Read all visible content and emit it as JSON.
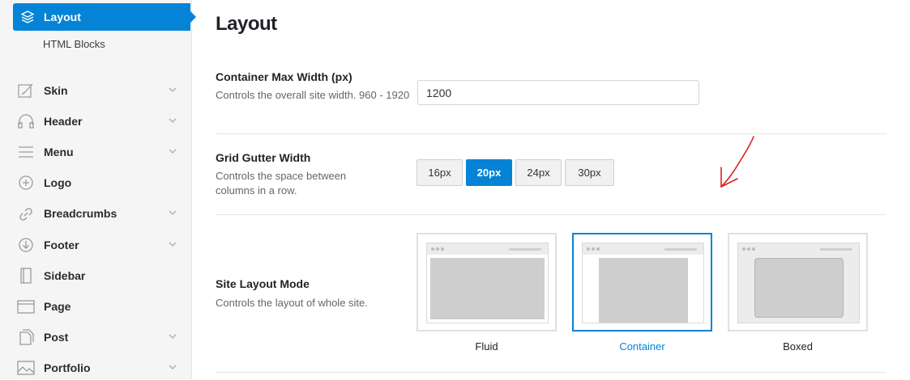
{
  "sidebar": {
    "active": {
      "label": "Layout",
      "icon": "layers-icon"
    },
    "sub_items": [
      {
        "label": "HTML Blocks"
      }
    ],
    "items": [
      {
        "label": "Skin",
        "icon": "skin-icon",
        "has_children": true
      },
      {
        "label": "Header",
        "icon": "headphones-icon",
        "has_children": true
      },
      {
        "label": "Menu",
        "icon": "menu-icon",
        "has_children": true
      },
      {
        "label": "Logo",
        "icon": "plus-circle-icon",
        "has_children": false
      },
      {
        "label": "Breadcrumbs",
        "icon": "link-icon",
        "has_children": true
      },
      {
        "label": "Footer",
        "icon": "arrow-down-circle-icon",
        "has_children": true
      },
      {
        "label": "Sidebar",
        "icon": "sidebar-icon",
        "has_children": false
      },
      {
        "label": "Page",
        "icon": "page-icon",
        "has_children": false
      },
      {
        "label": "Post",
        "icon": "post-icon",
        "has_children": true
      },
      {
        "label": "Portfolio",
        "icon": "image-icon",
        "has_children": true
      }
    ]
  },
  "main": {
    "title": "Layout",
    "container_width": {
      "title": "Container Max Width (px)",
      "description": "Controls the overall site width. 960 - 1920",
      "value": "1200"
    },
    "gutter": {
      "title": "Grid Gutter Width",
      "description": "Controls the space between columns in a row.",
      "options": [
        "16px",
        "20px",
        "24px",
        "30px"
      ],
      "selected": "20px"
    },
    "layout_mode": {
      "title": "Site Layout Mode",
      "description": "Controls the layout of whole site.",
      "options": [
        "Fluid",
        "Container",
        "Boxed"
      ],
      "selected": "Container"
    }
  },
  "colors": {
    "accent": "#0583d6",
    "annotation": "#e02020"
  }
}
